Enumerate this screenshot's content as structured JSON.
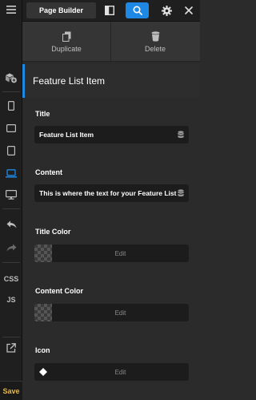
{
  "toolbar": {
    "title": "Page Builder",
    "icons": [
      "panel-toggle-icon",
      "search-icon",
      "gear-icon",
      "close-icon"
    ]
  },
  "sidebar": {
    "icons": [
      "add-element-icon",
      "mobile-icon",
      "tablet-landscape-icon",
      "tablet-icon",
      "laptop-icon",
      "desktop-icon",
      "undo-icon",
      "redo-icon",
      "css-button",
      "js-button",
      "external-link-icon"
    ],
    "css_label": "CSS",
    "js_label": "JS",
    "save_label": "Save",
    "active_item": "laptop-icon"
  },
  "actions": {
    "duplicate_label": "Duplicate",
    "delete_label": "Delete"
  },
  "panel": {
    "title": "Feature List Item"
  },
  "controls": {
    "title_label": "Title",
    "title_value": "Feature List Item",
    "content_label": "Content",
    "content_value": "This is where the text for your Feature List",
    "title_color_label": "Title Color",
    "content_color_label": "Content Color",
    "icon_label": "Icon",
    "edit_label": "Edit"
  },
  "colors": {
    "accent": "#1e88e5",
    "save": "#e2b84f",
    "background": "#2b2b2b",
    "field": "#1c1c1c"
  }
}
